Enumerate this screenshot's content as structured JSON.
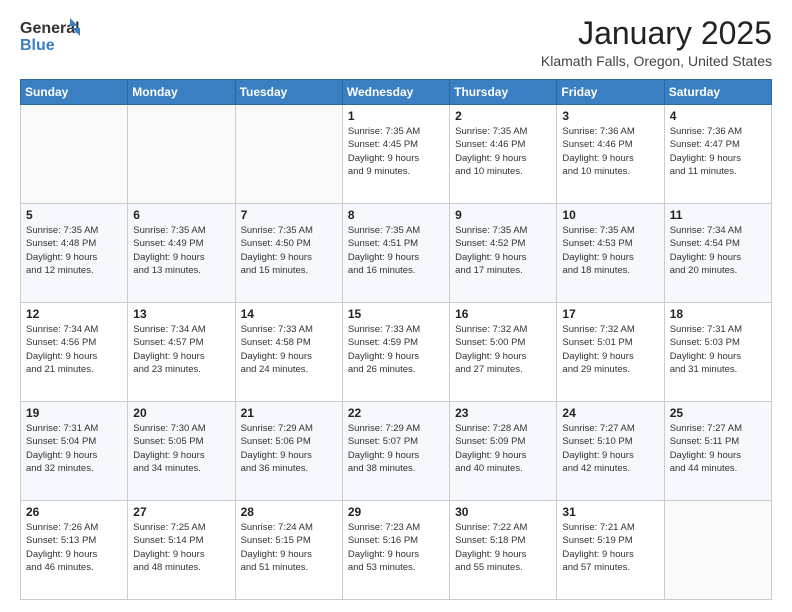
{
  "header": {
    "logo_line1": "General",
    "logo_line2": "Blue",
    "month": "January 2025",
    "location": "Klamath Falls, Oregon, United States"
  },
  "weekdays": [
    "Sunday",
    "Monday",
    "Tuesday",
    "Wednesday",
    "Thursday",
    "Friday",
    "Saturday"
  ],
  "weeks": [
    [
      {
        "day": "",
        "info": ""
      },
      {
        "day": "",
        "info": ""
      },
      {
        "day": "",
        "info": ""
      },
      {
        "day": "1",
        "info": "Sunrise: 7:35 AM\nSunset: 4:45 PM\nDaylight: 9 hours\nand 9 minutes."
      },
      {
        "day": "2",
        "info": "Sunrise: 7:35 AM\nSunset: 4:46 PM\nDaylight: 9 hours\nand 10 minutes."
      },
      {
        "day": "3",
        "info": "Sunrise: 7:36 AM\nSunset: 4:46 PM\nDaylight: 9 hours\nand 10 minutes."
      },
      {
        "day": "4",
        "info": "Sunrise: 7:36 AM\nSunset: 4:47 PM\nDaylight: 9 hours\nand 11 minutes."
      }
    ],
    [
      {
        "day": "5",
        "info": "Sunrise: 7:35 AM\nSunset: 4:48 PM\nDaylight: 9 hours\nand 12 minutes."
      },
      {
        "day": "6",
        "info": "Sunrise: 7:35 AM\nSunset: 4:49 PM\nDaylight: 9 hours\nand 13 minutes."
      },
      {
        "day": "7",
        "info": "Sunrise: 7:35 AM\nSunset: 4:50 PM\nDaylight: 9 hours\nand 15 minutes."
      },
      {
        "day": "8",
        "info": "Sunrise: 7:35 AM\nSunset: 4:51 PM\nDaylight: 9 hours\nand 16 minutes."
      },
      {
        "day": "9",
        "info": "Sunrise: 7:35 AM\nSunset: 4:52 PM\nDaylight: 9 hours\nand 17 minutes."
      },
      {
        "day": "10",
        "info": "Sunrise: 7:35 AM\nSunset: 4:53 PM\nDaylight: 9 hours\nand 18 minutes."
      },
      {
        "day": "11",
        "info": "Sunrise: 7:34 AM\nSunset: 4:54 PM\nDaylight: 9 hours\nand 20 minutes."
      }
    ],
    [
      {
        "day": "12",
        "info": "Sunrise: 7:34 AM\nSunset: 4:56 PM\nDaylight: 9 hours\nand 21 minutes."
      },
      {
        "day": "13",
        "info": "Sunrise: 7:34 AM\nSunset: 4:57 PM\nDaylight: 9 hours\nand 23 minutes."
      },
      {
        "day": "14",
        "info": "Sunrise: 7:33 AM\nSunset: 4:58 PM\nDaylight: 9 hours\nand 24 minutes."
      },
      {
        "day": "15",
        "info": "Sunrise: 7:33 AM\nSunset: 4:59 PM\nDaylight: 9 hours\nand 26 minutes."
      },
      {
        "day": "16",
        "info": "Sunrise: 7:32 AM\nSunset: 5:00 PM\nDaylight: 9 hours\nand 27 minutes."
      },
      {
        "day": "17",
        "info": "Sunrise: 7:32 AM\nSunset: 5:01 PM\nDaylight: 9 hours\nand 29 minutes."
      },
      {
        "day": "18",
        "info": "Sunrise: 7:31 AM\nSunset: 5:03 PM\nDaylight: 9 hours\nand 31 minutes."
      }
    ],
    [
      {
        "day": "19",
        "info": "Sunrise: 7:31 AM\nSunset: 5:04 PM\nDaylight: 9 hours\nand 32 minutes."
      },
      {
        "day": "20",
        "info": "Sunrise: 7:30 AM\nSunset: 5:05 PM\nDaylight: 9 hours\nand 34 minutes."
      },
      {
        "day": "21",
        "info": "Sunrise: 7:29 AM\nSunset: 5:06 PM\nDaylight: 9 hours\nand 36 minutes."
      },
      {
        "day": "22",
        "info": "Sunrise: 7:29 AM\nSunset: 5:07 PM\nDaylight: 9 hours\nand 38 minutes."
      },
      {
        "day": "23",
        "info": "Sunrise: 7:28 AM\nSunset: 5:09 PM\nDaylight: 9 hours\nand 40 minutes."
      },
      {
        "day": "24",
        "info": "Sunrise: 7:27 AM\nSunset: 5:10 PM\nDaylight: 9 hours\nand 42 minutes."
      },
      {
        "day": "25",
        "info": "Sunrise: 7:27 AM\nSunset: 5:11 PM\nDaylight: 9 hours\nand 44 minutes."
      }
    ],
    [
      {
        "day": "26",
        "info": "Sunrise: 7:26 AM\nSunset: 5:13 PM\nDaylight: 9 hours\nand 46 minutes."
      },
      {
        "day": "27",
        "info": "Sunrise: 7:25 AM\nSunset: 5:14 PM\nDaylight: 9 hours\nand 48 minutes."
      },
      {
        "day": "28",
        "info": "Sunrise: 7:24 AM\nSunset: 5:15 PM\nDaylight: 9 hours\nand 51 minutes."
      },
      {
        "day": "29",
        "info": "Sunrise: 7:23 AM\nSunset: 5:16 PM\nDaylight: 9 hours\nand 53 minutes."
      },
      {
        "day": "30",
        "info": "Sunrise: 7:22 AM\nSunset: 5:18 PM\nDaylight: 9 hours\nand 55 minutes."
      },
      {
        "day": "31",
        "info": "Sunrise: 7:21 AM\nSunset: 5:19 PM\nDaylight: 9 hours\nand 57 minutes."
      },
      {
        "day": "",
        "info": ""
      }
    ]
  ]
}
